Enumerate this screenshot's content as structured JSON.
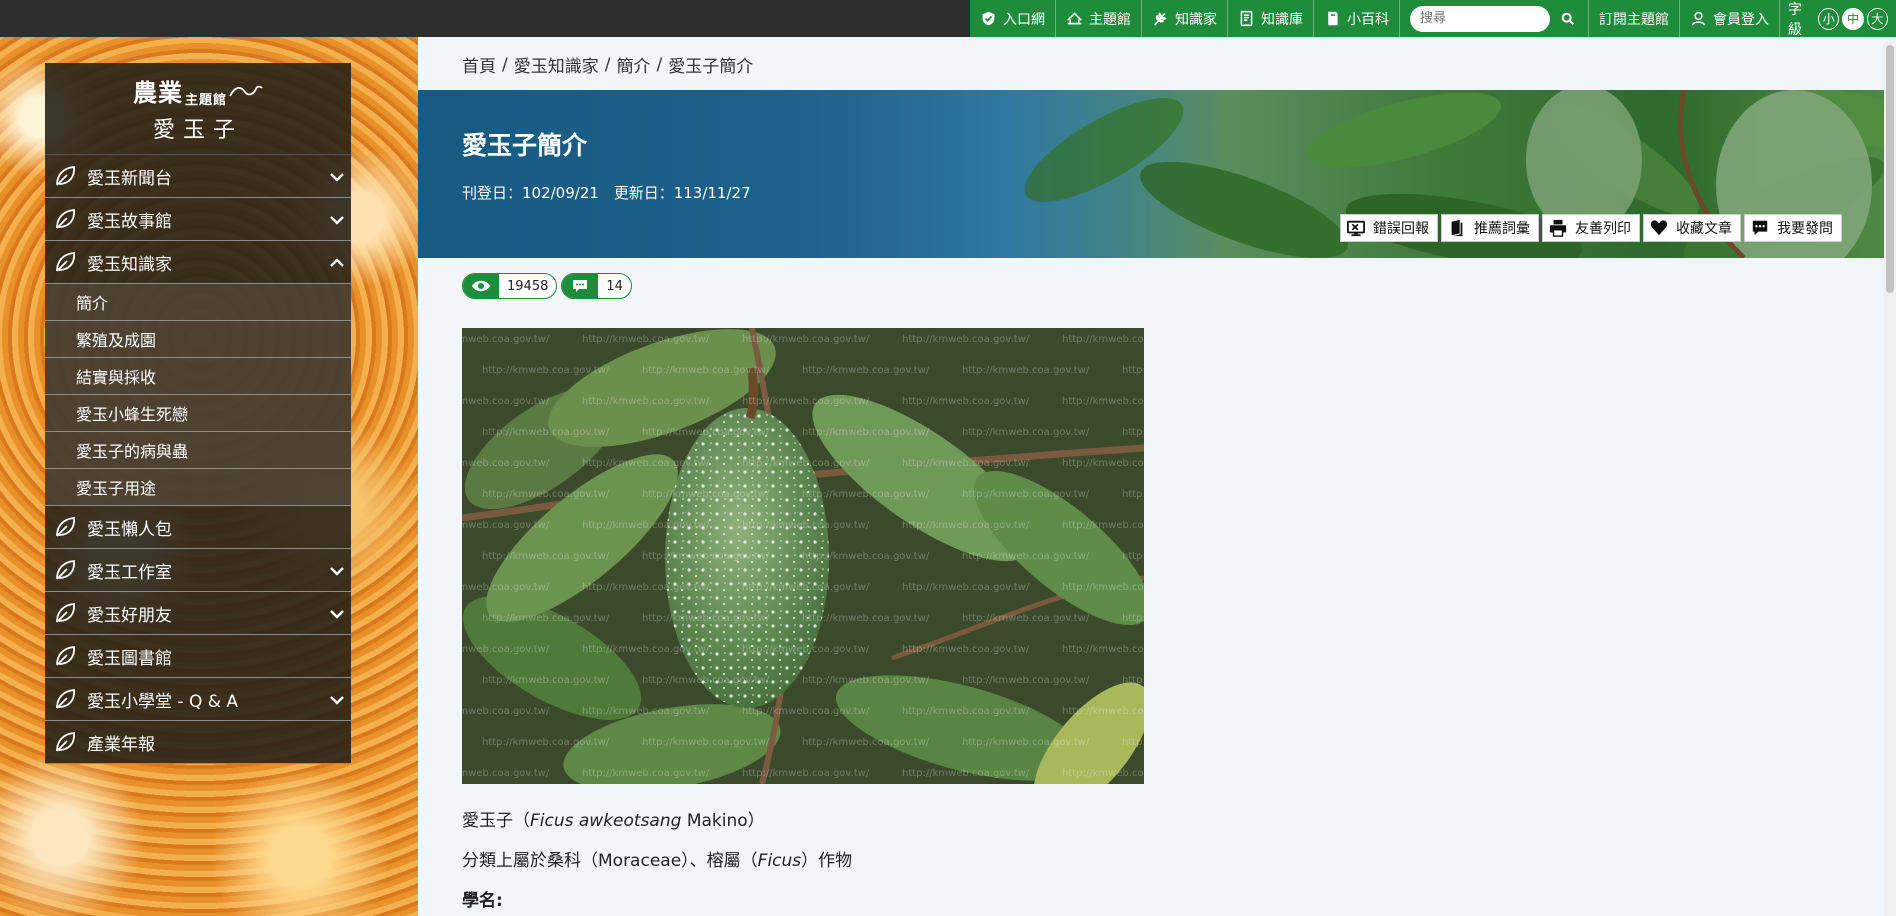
{
  "topnav": {
    "items": [
      {
        "label": "入口網",
        "icon": "shield-check-icon"
      },
      {
        "label": "主題館",
        "icon": "house-icon"
      },
      {
        "label": "知識家",
        "icon": "wheat-icon"
      },
      {
        "label": "知識庫",
        "icon": "notebook-icon"
      },
      {
        "label": "小百科",
        "icon": "book-icon"
      }
    ],
    "search_placeholder": "搜尋",
    "subscribe_label": "訂閱主題館",
    "login_label": "會員登入",
    "fontsize_label": "字級",
    "fontsize_options": [
      "小",
      "中",
      "大"
    ],
    "fontsize_selected": "中",
    "accent_color": "#1e8c3a"
  },
  "sidebar": {
    "logo_line1": "農業",
    "logo_line1_small": "主題館",
    "logo_line2": "愛玉子",
    "items": [
      {
        "label": "愛玉新聞台",
        "chevron": "down"
      },
      {
        "label": "愛玉故事館",
        "chevron": "down"
      },
      {
        "label": "愛玉知識家",
        "chevron": "up"
      },
      {
        "label": "愛玉懶人包",
        "chevron": "none"
      },
      {
        "label": "愛玉工作室",
        "chevron": "down"
      },
      {
        "label": "愛玉好朋友",
        "chevron": "down"
      },
      {
        "label": "愛玉圖書館",
        "chevron": "none"
      },
      {
        "label": "愛玉小學堂 - Q & A",
        "chevron": "down"
      },
      {
        "label": "產業年報",
        "chevron": "none"
      }
    ],
    "submenu": [
      "簡介",
      "繁殖及成園",
      "結實與採收",
      "愛玉小蜂生死戀",
      "愛玉子的病與蟲",
      "愛玉子用途"
    ]
  },
  "breadcrumb": [
    "首頁",
    "愛玉知識家",
    "簡介",
    "愛玉子簡介"
  ],
  "article": {
    "title": "愛玉子簡介",
    "published": "刊登日：102/09/21",
    "updated": "更新日：113/11/27",
    "actions": [
      {
        "label": "錯誤回報",
        "icon": "report-error-icon"
      },
      {
        "label": "推薦詞彙",
        "icon": "recommend-book-icon"
      },
      {
        "label": "友善列印",
        "icon": "printer-icon"
      },
      {
        "label": "收藏文章",
        "icon": "heart-icon"
      },
      {
        "label": "我要發問",
        "icon": "speech-bubble-icon"
      }
    ],
    "views": "19458",
    "comments": "14",
    "watermark": "http://kmweb.coa.gov.tw/",
    "line1_prefix": "愛玉子（",
    "line1_italic": "Ficus awkeotsang",
    "line1_suffix": " Makino）",
    "line2_prefix": "分類上屬於桑科（Moraceae）、榕屬（",
    "line2_italic": "Ficus",
    "line2_suffix": "）作物",
    "line3": "學名:"
  }
}
